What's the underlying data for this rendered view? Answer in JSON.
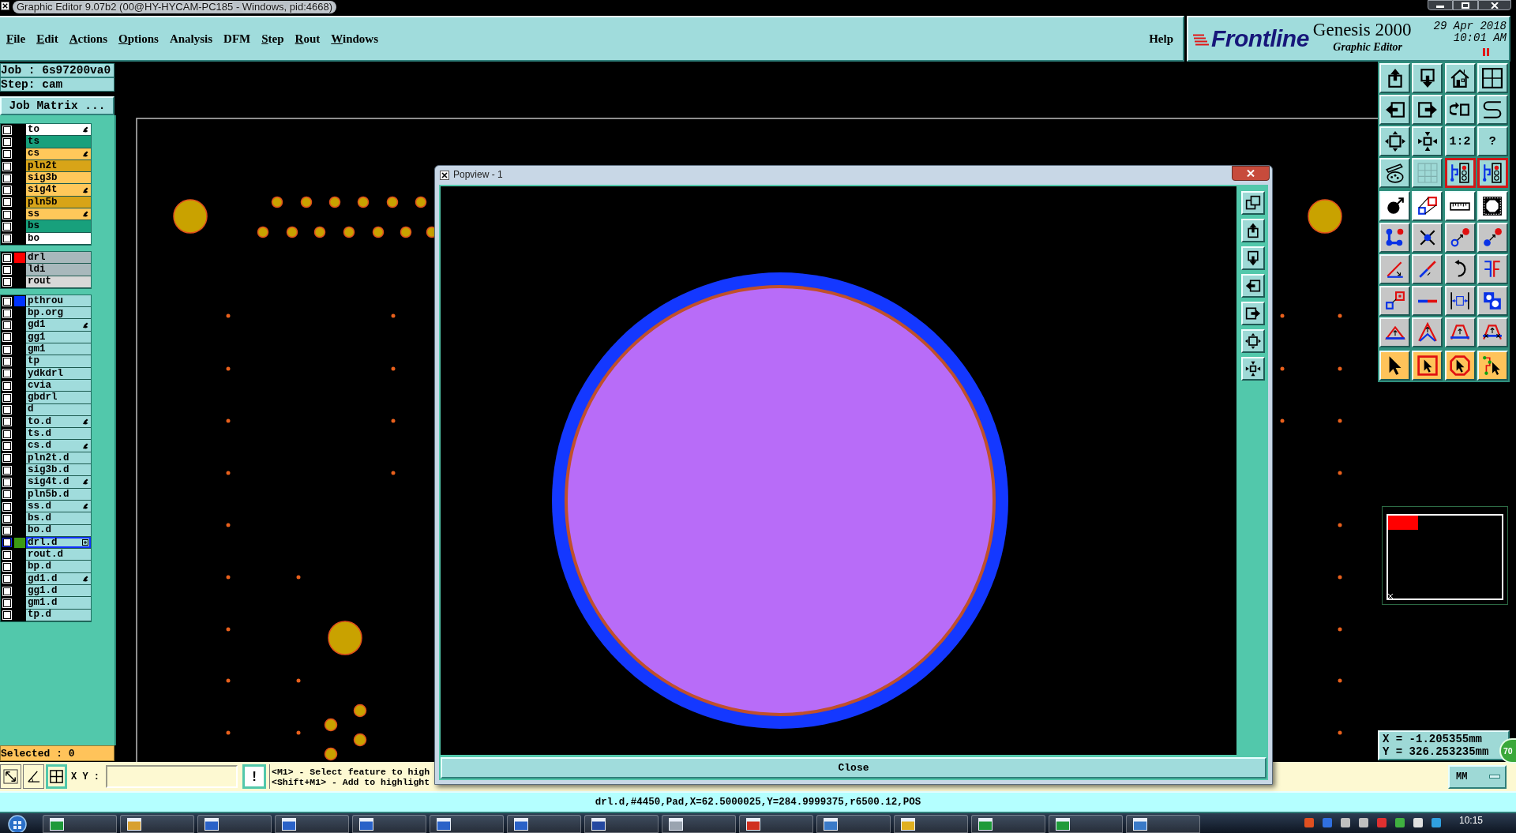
{
  "window": {
    "title": "Graphic Editor 9.07b2 (00@HY-HYCAM-PC185 - Windows, pid:4668)"
  },
  "menu": [
    {
      "label": "File",
      "mnemonic": true
    },
    {
      "label": "Edit",
      "mnemonic": true
    },
    {
      "label": "Actions",
      "mnemonic": true
    },
    {
      "label": "Options",
      "mnemonic": true
    },
    {
      "label": "Analysis",
      "mnemonic": false
    },
    {
      "label": "DFM",
      "mnemonic": false
    },
    {
      "label": "Step",
      "mnemonic": true
    },
    {
      "label": "Rout",
      "mnemonic": true
    },
    {
      "label": "Windows",
      "mnemonic": true
    }
  ],
  "help": {
    "label": "Help"
  },
  "brand": {
    "company": "Frontline",
    "product": "Genesis 2000",
    "module": "Graphic Editor",
    "date": "29 Apr 2018",
    "time": "10:01 AM"
  },
  "job": {
    "job": "Job : 6s97200va0",
    "step": "Step: cam",
    "matrix_button": "Job Matrix ..."
  },
  "layer_groups": [
    {
      "layers": [
        {
          "name": "to",
          "color": "#ffffff",
          "checked": false,
          "marked": true,
          "selected": false
        },
        {
          "name": "ts",
          "color": "#18a07c",
          "checked": false,
          "marked": false,
          "selected": false
        },
        {
          "name": "cs",
          "color": "#ffc85a",
          "checked": false,
          "marked": true,
          "selected": false
        },
        {
          "name": "pln2t",
          "color": "#d8a418",
          "checked": false,
          "marked": false,
          "selected": false
        },
        {
          "name": "sig3b",
          "color": "#ffc85a",
          "checked": false,
          "marked": false,
          "selected": false
        },
        {
          "name": "sig4t",
          "color": "#ffc85a",
          "checked": false,
          "marked": true,
          "selected": false
        },
        {
          "name": "pln5b",
          "color": "#d8a418",
          "checked": false,
          "marked": false,
          "selected": false
        },
        {
          "name": "ss",
          "color": "#ffc85a",
          "checked": false,
          "marked": true,
          "selected": false
        },
        {
          "name": "bs",
          "color": "#18a07c",
          "checked": false,
          "marked": false,
          "selected": false
        },
        {
          "name": "bo",
          "color": "#ffffff",
          "checked": false,
          "marked": false,
          "selected": false
        }
      ]
    },
    {
      "layers": [
        {
          "name": "drl",
          "color": "#a8b8bc",
          "swatch": {
            "color": "#ff0000"
          },
          "checked": false,
          "marked": false,
          "selected": false
        },
        {
          "name": "ldi",
          "color": "#a8b8bc",
          "checked": false,
          "marked": false,
          "selected": false
        },
        {
          "name": "rout",
          "color": "#d8d8d8",
          "checked": false,
          "marked": false,
          "selected": false
        }
      ]
    },
    {
      "layers": [
        {
          "name": "pthrou",
          "color": "#a0dcdc",
          "swatch": {
            "color": "#0033ff"
          },
          "checked": false,
          "marked": false,
          "selected": false
        },
        {
          "name": "bp.org",
          "color": "#a0dcdc",
          "checked": false,
          "marked": false,
          "selected": false
        },
        {
          "name": "gd1",
          "color": "#a0dcdc",
          "checked": false,
          "marked": true,
          "selected": false
        },
        {
          "name": "gg1",
          "color": "#a0dcdc",
          "checked": false,
          "marked": false,
          "selected": false
        },
        {
          "name": "gm1",
          "color": "#a0dcdc",
          "checked": false,
          "marked": false,
          "selected": false
        },
        {
          "name": "tp",
          "color": "#a0dcdc",
          "checked": false,
          "marked": false,
          "selected": false
        },
        {
          "name": "ydkdrl",
          "color": "#a0dcdc",
          "checked": false,
          "marked": false,
          "selected": false
        },
        {
          "name": "cvia",
          "color": "#a0dcdc",
          "checked": false,
          "marked": false,
          "selected": false
        },
        {
          "name": "gbdrl",
          "color": "#a0dcdc",
          "checked": false,
          "marked": false,
          "selected": false
        },
        {
          "name": "d",
          "color": "#a0dcdc",
          "checked": false,
          "marked": false,
          "selected": false
        },
        {
          "name": "to.d",
          "color": "#a0dcdc",
          "checked": false,
          "marked": true,
          "selected": false
        },
        {
          "name": "ts.d",
          "color": "#a0dcdc",
          "checked": false,
          "marked": false,
          "selected": false
        },
        {
          "name": "cs.d",
          "color": "#a0dcdc",
          "checked": false,
          "marked": true,
          "selected": false
        },
        {
          "name": "pln2t.d",
          "color": "#a0dcdc",
          "checked": false,
          "marked": false,
          "selected": false
        },
        {
          "name": "sig3b.d",
          "color": "#a0dcdc",
          "checked": false,
          "marked": false,
          "selected": false
        },
        {
          "name": "sig4t.d",
          "color": "#a0dcdc",
          "checked": false,
          "marked": true,
          "selected": false
        },
        {
          "name": "pln5b.d",
          "color": "#a0dcdc",
          "checked": false,
          "marked": false,
          "selected": false
        },
        {
          "name": "ss.d",
          "color": "#a0dcdc",
          "checked": false,
          "marked": true,
          "selected": false
        },
        {
          "name": "bs.d",
          "color": "#a0dcdc",
          "checked": false,
          "marked": false,
          "selected": false
        },
        {
          "name": "bo.d",
          "color": "#a0dcdc",
          "checked": false,
          "marked": false,
          "selected": false
        },
        {
          "name": "drl.d",
          "color": "#a0dcdc",
          "swatch": {
            "color": "#3c9a14"
          },
          "checked": false,
          "marked": false,
          "selected": true
        },
        {
          "name": "rout.d",
          "color": "#a0dcdc",
          "checked": false,
          "marked": false,
          "selected": false
        },
        {
          "name": "bp.d",
          "color": "#a0dcdc",
          "checked": false,
          "marked": false,
          "selected": false
        },
        {
          "name": "gd1.d",
          "color": "#a0dcdc",
          "checked": false,
          "marked": true,
          "selected": false
        },
        {
          "name": "gg1.d",
          "color": "#a0dcdc",
          "checked": false,
          "marked": false,
          "selected": false
        },
        {
          "name": "gm1.d",
          "color": "#a0dcdc",
          "checked": false,
          "marked": false,
          "selected": false
        },
        {
          "name": "tp.d",
          "color": "#a0dcdc",
          "checked": false,
          "marked": false,
          "selected": false
        }
      ]
    }
  ],
  "selection": "Selected : 0",
  "tool_panel": {
    "groups": [
      {
        "kind": "view",
        "buttons": [
          {
            "kind": "icon",
            "on": false
          },
          {
            "kind": "icon",
            "on": false
          },
          {
            "kind": "icon",
            "on": false
          },
          {
            "kind": "icon",
            "on": false
          },
          {
            "kind": "icon",
            "on": false
          },
          {
            "kind": "icon",
            "on": false
          },
          {
            "kind": "icon",
            "on": false
          },
          {
            "kind": "icon",
            "on": false
          },
          {
            "kind": "icon",
            "on": false
          },
          {
            "kind": "icon",
            "on": false
          },
          {
            "kind": "text",
            "label": "1:2",
            "on": false
          },
          {
            "kind": "text",
            "label": "?",
            "on": false
          },
          {
            "kind": "icon",
            "on": false
          },
          {
            "kind": "icon",
            "on": false
          },
          {
            "kind": "icon",
            "on": true
          },
          {
            "kind": "icon",
            "on": true
          }
        ]
      },
      {
        "kind": "edit",
        "buttons": [
          {
            "kind": "icon",
            "on": false
          },
          {
            "kind": "icon",
            "on": false
          },
          {
            "kind": "icon",
            "on": false
          },
          {
            "kind": "icon",
            "on": false
          },
          {
            "kind": "icon",
            "on": false
          },
          {
            "kind": "icon",
            "on": false
          },
          {
            "kind": "icon",
            "on": false
          },
          {
            "kind": "icon",
            "on": false
          },
          {
            "kind": "icon",
            "on": false
          },
          {
            "kind": "icon",
            "on": false
          },
          {
            "kind": "icon",
            "on": false
          },
          {
            "kind": "icon",
            "on": false
          },
          {
            "kind": "icon",
            "on": false
          },
          {
            "kind": "icon",
            "on": false
          },
          {
            "kind": "icon",
            "on": false
          },
          {
            "kind": "icon",
            "on": false
          },
          {
            "kind": "icon",
            "on": false
          },
          {
            "kind": "icon",
            "on": false
          },
          {
            "kind": "icon",
            "on": false
          },
          {
            "kind": "icon",
            "on": false
          }
        ]
      },
      {
        "kind": "select",
        "buttons": [
          {
            "kind": "icon",
            "on": false
          },
          {
            "kind": "icon",
            "on": false
          },
          {
            "kind": "icon",
            "on": false
          },
          {
            "kind": "icon",
            "on": false
          }
        ]
      }
    ]
  },
  "cursor": {
    "x": "X = -1.205355mm",
    "y": "Y = 326.253235mm"
  },
  "badge": "70",
  "coordinate_bar": {
    "tools": [
      {
        "on": false
      },
      {
        "on": false
      },
      {
        "on": true
      }
    ],
    "label": "X Y :",
    "alert": "!",
    "hints": [
      "<M1> - Select feature to high",
      "<Shift+M1> - Add to highlight"
    ],
    "units": "MM"
  },
  "status_bar": {
    "text": "drl.d,#4450,Pad,X=62.5000025,Y=284.9999375,r6500.12,POS"
  },
  "popview": {
    "title": "Popview - 1",
    "close_button": "Close"
  },
  "taskbar": {
    "clock": "10:15"
  }
}
